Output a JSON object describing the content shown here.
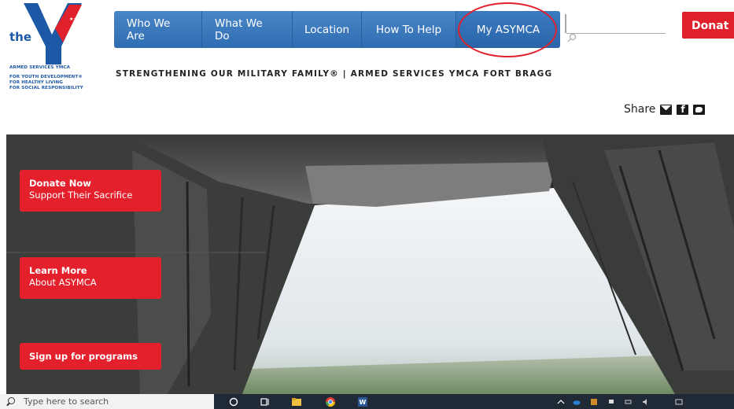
{
  "logo": {
    "word": "the",
    "org": "ARMED SERVICES YMCA",
    "lines": [
      "FOR YOUTH DEVELOPMENT®",
      "FOR HEALTHY LIVING",
      "FOR SOCIAL RESPONSIBILITY"
    ]
  },
  "nav": {
    "items": [
      {
        "label": "Who We Are"
      },
      {
        "label": "What We Do"
      },
      {
        "label": "Location"
      },
      {
        "label": "How To Help"
      },
      {
        "label": "My ASYMCA"
      }
    ]
  },
  "search": {
    "value": "",
    "placeholder": ""
  },
  "donate_button": "Donat",
  "tagline": "STRENGTHENING OUR MILITARY FAMILY® | ARMED SERVICES YMCA FORT BRAGG",
  "share": {
    "label": "Share",
    "icons": [
      "mail-icon",
      "facebook-icon",
      "twitter-icon"
    ]
  },
  "hero": {
    "cta": [
      {
        "title": "Donate Now",
        "subtitle": "Support Their Sacrifice"
      },
      {
        "title": "Learn More",
        "subtitle": "About ASYMCA"
      },
      {
        "title": "Sign up for programs",
        "subtitle": ""
      }
    ]
  },
  "taskbar": {
    "search_placeholder": "Type here to search",
    "icons": [
      "search-icon",
      "task-view-icon",
      "file-explorer-icon",
      "chrome-icon",
      "word-icon"
    ]
  },
  "colors": {
    "nav_blue": "#3a78bd",
    "red": "#e3202b",
    "logo_blue": "#1d58a6"
  }
}
